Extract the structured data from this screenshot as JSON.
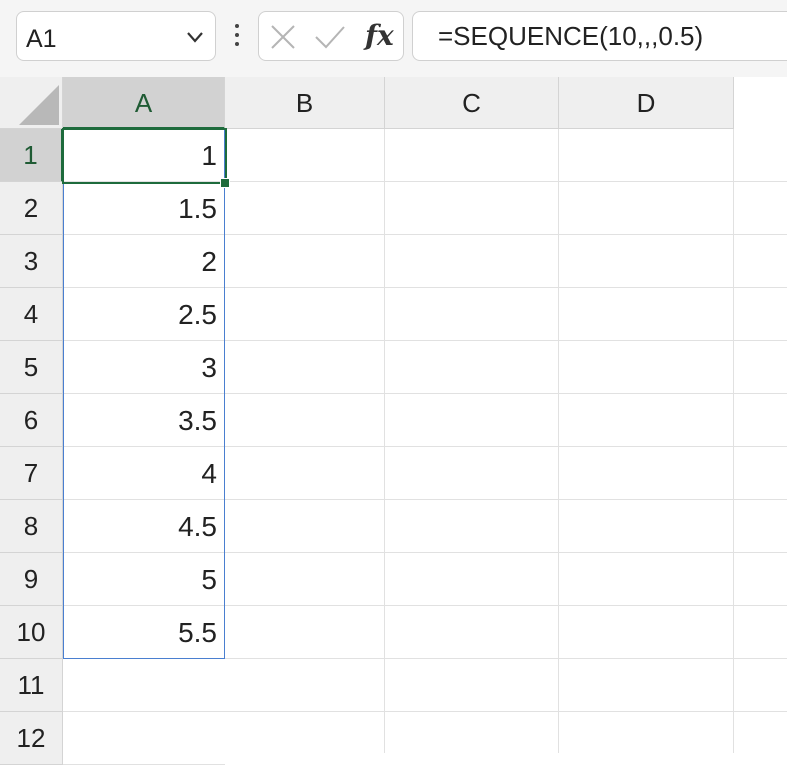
{
  "name_box": {
    "value": "A1"
  },
  "formula_bar": {
    "formula": "=SEQUENCE(10,,,0.5)"
  },
  "icons": {
    "cancel": "x-icon",
    "enter": "check-icon",
    "insert_function": "fx",
    "menu": "more-vertical-icon",
    "dropdown": "chevron-down-icon"
  },
  "columns": [
    {
      "label": "A",
      "selected": true
    },
    {
      "label": "B",
      "selected": false
    },
    {
      "label": "C",
      "selected": false
    },
    {
      "label": "D",
      "selected": false
    }
  ],
  "rows": [
    {
      "label": "1",
      "a": "1",
      "selected": true
    },
    {
      "label": "2",
      "a": "1.5"
    },
    {
      "label": "3",
      "a": "2"
    },
    {
      "label": "4",
      "a": "2.5"
    },
    {
      "label": "5",
      "a": "3"
    },
    {
      "label": "6",
      "a": "3.5"
    },
    {
      "label": "7",
      "a": "4"
    },
    {
      "label": "8",
      "a": "4.5"
    },
    {
      "label": "9",
      "a": "5"
    },
    {
      "label": "10",
      "a": "5.5"
    },
    {
      "label": "11",
      "a": ""
    },
    {
      "label": "12",
      "a": ""
    }
  ],
  "colors": {
    "accent": "#1e6b3c",
    "spill_border": "#4a7fd0",
    "header_bg": "#efefef",
    "selected_header_bg": "#d2d2d2"
  }
}
